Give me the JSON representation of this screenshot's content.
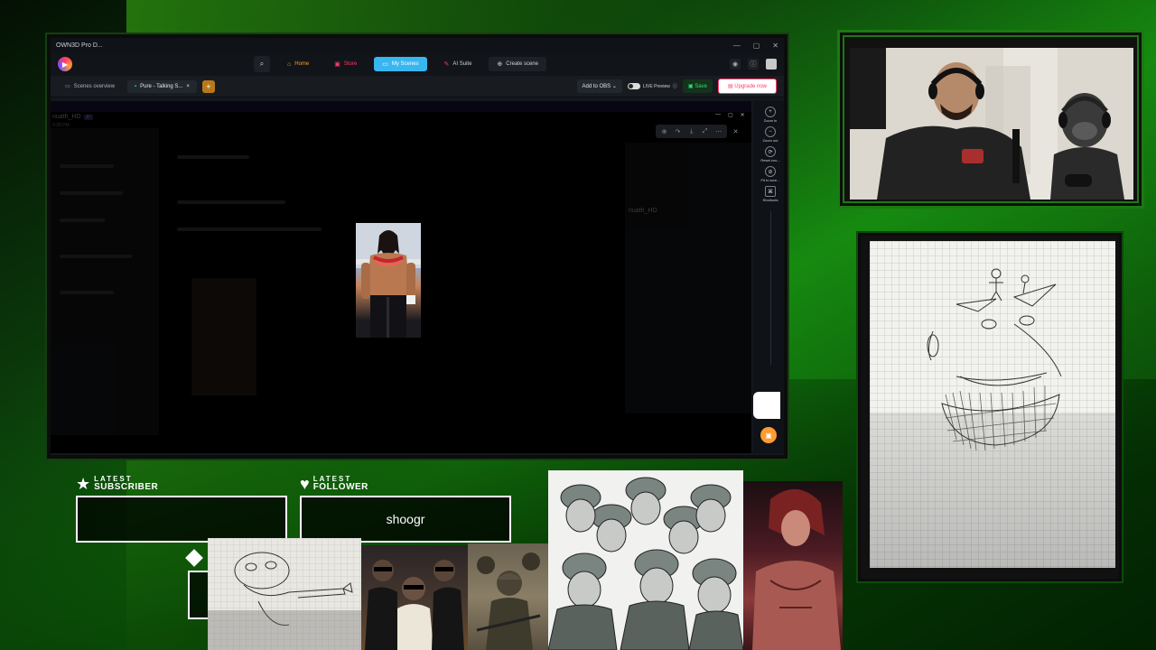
{
  "app": {
    "title": "OWN3D Pro D...",
    "window_controls": [
      "—",
      "▢",
      "✕"
    ],
    "logo_icon": "play-logo",
    "nav": {
      "search_icon": "search-icon",
      "home": "Home",
      "store": "Store",
      "my_scenes": "My Scenes",
      "ai_suite": "AI Suite",
      "create_scene": "Create scene"
    },
    "right_icons": [
      "eye-icon",
      "info-icon"
    ],
    "tabs": {
      "overview": "Scenes overview",
      "active": "Pure - Talking S...",
      "close": "×",
      "add": "+"
    },
    "toolbar": {
      "add_to_obs": "Add to OBS",
      "live_preview": "LIVE Preview",
      "save": "Save",
      "upgrade": "Upgrade now"
    },
    "accent_color": "#38b6f0",
    "brand_color": "#ff3c6a",
    "save_color": "#2ee06f"
  },
  "canvas": {
    "ghost_user": "nuath_HD",
    "ghost_badge": "87",
    "ghost_time": "0:28 PM",
    "ghost_profile_name": "nuath_HD",
    "toolbar_icons": [
      "zoom-in-icon",
      "redo-icon",
      "download-icon",
      "expand-icon",
      "more-icon",
      "close-icon"
    ]
  },
  "tools": [
    {
      "icon": "zoom-in-icon",
      "label": "Zoom in"
    },
    {
      "icon": "zoom-out-icon",
      "label": "Zoom out"
    },
    {
      "icon": "reset-zoom-icon",
      "label": "Reset zoo..."
    },
    {
      "icon": "fit-screen-icon",
      "label": "Fit to scre..."
    },
    {
      "icon": "shortcuts-icon",
      "label": "Shortcuts"
    }
  ],
  "alerts": {
    "subscriber": {
      "small": "LATEST",
      "big": "SUBSCRIBER",
      "value": "",
      "icon": "star-icon"
    },
    "follower": {
      "small": "LATEST",
      "big": "FOLLOWER",
      "value": "shoogr",
      "icon": "heart-icon"
    },
    "third": {
      "icon": "diamond-icon"
    }
  },
  "overlay_colors": {
    "frame_green": "#1a7a10",
    "background": "#0b3a0b"
  }
}
